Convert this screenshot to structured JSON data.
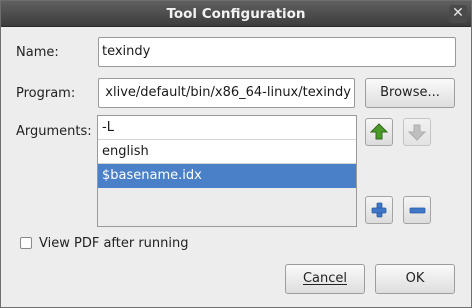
{
  "window": {
    "title": "Tool Configuration",
    "close_glyph": "✕"
  },
  "form": {
    "name_label": "Name:",
    "name_value": "texindy",
    "program_label": "Program:",
    "program_value": "xlive/default/bin/x86_64-linux/texindy",
    "browse_label": "Browse...",
    "arguments_label": "Arguments:",
    "arguments": [
      "-L",
      "english",
      "$basename.idx"
    ],
    "selected_argument_index": 2,
    "view_pdf_label": "View PDF after running",
    "view_pdf_checked": false
  },
  "icons": {
    "move_up": "arrow-up-icon",
    "move_down": "arrow-down-icon",
    "add": "plus-icon",
    "remove": "minus-icon"
  },
  "buttons": {
    "cancel": "Cancel",
    "ok": "OK"
  },
  "colors": {
    "selection": "#4a80c8",
    "arrow_up": "#4a9a2a",
    "plus_minus": "#3f78c8"
  }
}
